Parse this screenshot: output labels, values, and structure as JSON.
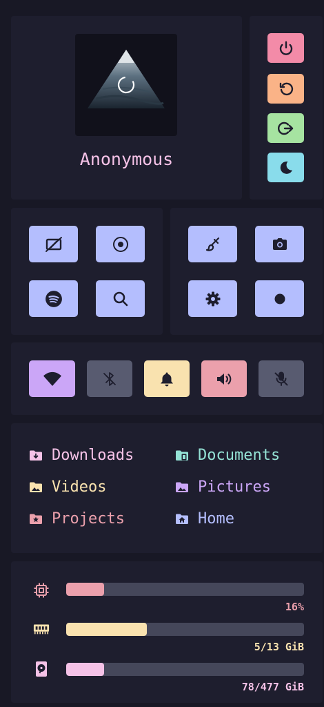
{
  "colors": {
    "background": "#181825",
    "panel": "#1e1e2e",
    "lavender": "#b4befe",
    "red": "#f38ba8",
    "peach": "#fab387",
    "green": "#a6e3a1",
    "sky": "#89dceb",
    "mauve": "#cba6f7",
    "yellow": "#f9e2af",
    "pink": "#f5c2e7",
    "teal": "#94e2d5",
    "surface": "#585b70",
    "muted_red": "#eba0ac"
  },
  "profile": {
    "username": "Anonymous",
    "avatar_icon": "illuminati-pyramid-avatar"
  },
  "power_menu": [
    {
      "name": "power-button",
      "icon": "power-icon",
      "color": "#f38ba8"
    },
    {
      "name": "reboot-button",
      "icon": "restart-icon",
      "color": "#fab387"
    },
    {
      "name": "logout-button",
      "icon": "logout-icon",
      "color": "#a6e3a1"
    },
    {
      "name": "sleep-button",
      "icon": "moon-icon",
      "color": "#89dceb"
    }
  ],
  "apps_left": [
    {
      "name": "screen-off-button",
      "icon": "screen-off-icon"
    },
    {
      "name": "disc-button",
      "icon": "disc-icon"
    },
    {
      "name": "spotify-button",
      "icon": "spotify-icon"
    },
    {
      "name": "search-button",
      "icon": "search-icon"
    }
  ],
  "apps_right": [
    {
      "name": "paint-brush-button",
      "icon": "brush-icon"
    },
    {
      "name": "screenshot-button",
      "icon": "camera-icon"
    },
    {
      "name": "settings-button",
      "icon": "gear-icon"
    },
    {
      "name": "record-button",
      "icon": "record-icon"
    }
  ],
  "toggles": [
    {
      "name": "wifi-toggle",
      "icon": "wifi-icon",
      "active": true,
      "color": "#cba6f7"
    },
    {
      "name": "bluetooth-toggle",
      "icon": "bluetooth-off-icon",
      "active": false,
      "color": "#585b70"
    },
    {
      "name": "notifications-toggle",
      "icon": "bell-icon",
      "active": true,
      "color": "#f9e2af"
    },
    {
      "name": "volume-toggle",
      "icon": "volume-icon",
      "active": true,
      "color": "#eba0ac"
    },
    {
      "name": "microphone-toggle",
      "icon": "mic-off-icon",
      "active": false,
      "color": "#585b70"
    }
  ],
  "folders": [
    {
      "label": "Downloads",
      "icon": "folder-download-icon",
      "color": "#f5c2e7"
    },
    {
      "label": "Documents",
      "icon": "folder-documents-icon",
      "color": "#94e2d5"
    },
    {
      "label": "Videos",
      "icon": "folder-videos-icon",
      "color": "#f9e2af"
    },
    {
      "label": "Pictures",
      "icon": "folder-pictures-icon",
      "color": "#cba6f7"
    },
    {
      "label": "Projects",
      "icon": "folder-projects-icon",
      "color": "#eba0ac"
    },
    {
      "label": "Home",
      "icon": "folder-home-icon",
      "color": "#b4befe"
    }
  ],
  "resources": [
    {
      "name": "cpu",
      "icon": "cpu-icon",
      "label": "16%",
      "fraction": 0.16,
      "color": "#eba0ac"
    },
    {
      "name": "ram",
      "icon": "memory-icon",
      "label": "5/13 GiB",
      "fraction": 0.34,
      "color": "#f9e2af"
    },
    {
      "name": "disk",
      "icon": "disk-icon",
      "label": "78/477 GiB",
      "fraction": 0.16,
      "color": "#f5c2e7"
    }
  ]
}
